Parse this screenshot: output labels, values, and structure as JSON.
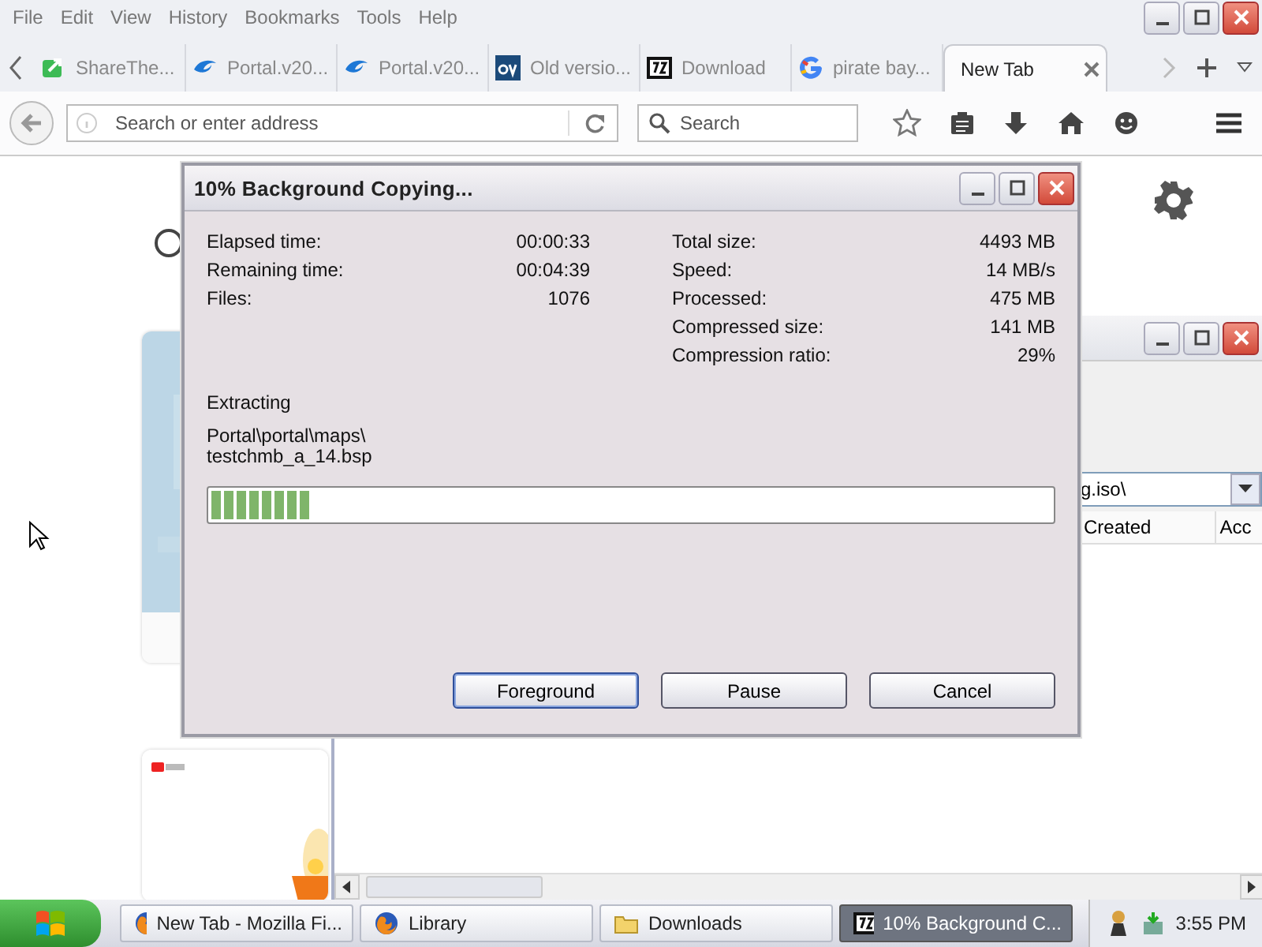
{
  "browser": {
    "menu": [
      "File",
      "Edit",
      "View",
      "History",
      "Bookmarks",
      "Tools",
      "Help"
    ],
    "tabs": [
      {
        "label": "ShareThe...",
        "selected": false
      },
      {
        "label": "Portal.v20...",
        "selected": false
      },
      {
        "label": "Portal.v20...",
        "selected": false
      },
      {
        "label": "Old versio...",
        "selected": false
      },
      {
        "label": "Download",
        "selected": false
      },
      {
        "label": "pirate bay...",
        "selected": false
      },
      {
        "label": "New Tab",
        "selected": true
      }
    ],
    "address": {
      "placeholder": "Search or enter address"
    },
    "search": {
      "placeholder": "Search"
    }
  },
  "library_window": {
    "path_field": {
      "value": "g.iso\\"
    },
    "columns": [
      "Created",
      "Acc"
    ]
  },
  "dialog": {
    "title": "10% Background Copying...",
    "left_stats": [
      {
        "label": "Elapsed time:",
        "value": "00:00:33"
      },
      {
        "label": "Remaining time:",
        "value": "00:04:39"
      },
      {
        "label": "Files:",
        "value": "1076"
      }
    ],
    "right_stats": [
      {
        "label": "Total size:",
        "value": "4493 MB"
      },
      {
        "label": "Speed:",
        "value": "14 MB/s"
      },
      {
        "label": "Processed:",
        "value": "475 MB"
      },
      {
        "label": "Compressed size:",
        "value": "141 MB"
      },
      {
        "label": "Compression ratio:",
        "value": "29%"
      }
    ],
    "status": "Extracting",
    "path_lines": [
      "Portal\\portal\\maps\\",
      "testchmb_a_14.bsp"
    ],
    "progress": {
      "level": 0.12
    },
    "buttons": [
      "Foreground",
      "Pause",
      "Cancel"
    ]
  },
  "taskbar": {
    "items": [
      {
        "label": "New Tab - Mozilla Fi...",
        "selected": false
      },
      {
        "label": "Library",
        "selected": false
      },
      {
        "label": "Downloads",
        "selected": false
      },
      {
        "label": "10% Background C...",
        "selected": true
      }
    ],
    "clock": "3:55 PM"
  }
}
